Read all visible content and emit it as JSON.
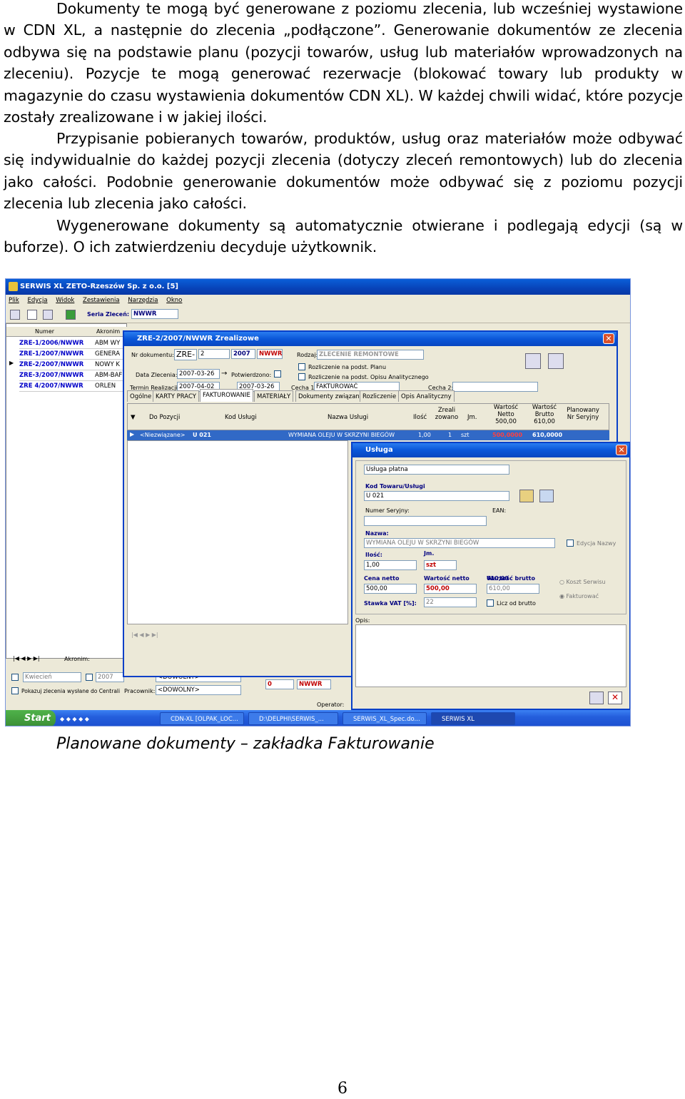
{
  "text": {
    "para1": "Dokumenty te mogą być generowane z poziomu zlecenia, lub wcześniej wystawione w CDN XL, a następnie do zlecenia „podłączone”. Generowanie dokumentów ze zlecenia odbywa się na podstawie planu (pozycji towarów, usług lub materiałów wprowadzonych na zleceniu). Pozycje te mogą generować rezerwacje (blokować towary lub produkty w magazynie do czasu wystawienia dokumentów CDN XL). W każdej chwili widać, które pozycje zostały zrealizowane  i w jakiej ilości.",
    "para2": "Przypisanie pobieranych towarów, produktów, usług oraz materiałów może odbywać się indywidualnie do każdej pozycji zlecenia (dotyczy zleceń remontowych) lub do zlecenia jako całości. Podobnie generowanie dokumentów może odbywać się z poziomu pozycji zlecenia lub zlecenia jako całości.",
    "para3": "Wygenerowane dokumenty są automatycznie otwierane i podlegają edycji (są w buforze). O ich zatwierdzeniu decyduje użytkownik.",
    "caption": "Planowane dokumenty – zakładka Fakturowanie",
    "page_number": "6"
  },
  "app": {
    "title": "SERWIS XL   ZETO-Rzeszów Sp. z o.o.  [5]",
    "menu": [
      "Plik",
      "Edycja",
      "Widok",
      "Zestawienia",
      "Narzędzia",
      "Okno"
    ],
    "seria_label": "Seria Zleceń:",
    "seria_value": "NWWR",
    "col_numer": "Numer",
    "col_akronim": "Akronim",
    "rows": [
      {
        "num": "ZRE-1/2006/NWWR",
        "akr": "ABM WY"
      },
      {
        "num": "ZRE-1/2007/NWWR",
        "akr": "GENERA"
      },
      {
        "num": "ZRE-2/2007/NWWR",
        "akr": "NOWY K"
      },
      {
        "num": "ZRE-3/2007/NWWR",
        "akr": "ABM-BAF"
      },
      {
        "num": "ZRE 4/2007/NWWR",
        "akr": "ORLEN"
      }
    ],
    "akronim_label": "Akronim:",
    "kwiecien": "Kwiecień",
    "year": "2007",
    "pokazuj": "Pokazuj zlecenia wysłane do Centrali",
    "pracownik_label": "Pracownik:",
    "pracownik_value": "<DOWOLNY>",
    "podzial_value": "<DOWOLNY>",
    "filter_num": "0",
    "filter_series": "NWWR",
    "operator_label": "Operator:"
  },
  "zre": {
    "title": "ZRE-2/2007/NWWR   Zrealizowe",
    "nr_label": "Nr dokumentu:",
    "nr_prefix": "ZRE-",
    "nr_num": "2",
    "nr_year": "2007",
    "nr_series": "NWWR",
    "rodzaj_label": "Rodzaj:",
    "rodzaj_value": "ZLECENIE REMONTOWE",
    "rozl_plan": "Rozliczenie na podst. Planu",
    "rozl_opis": "Rozliczenie na podst. Opisu Analitycznego",
    "data_label": "Data Zlecenia:",
    "data_value": "2007-03-26",
    "potw_label": "Potwierdzono:",
    "potw_value": "2007-03-26",
    "termin_label": "Termin Realizacji:",
    "termin_value": "2007-04-02",
    "cecha1_label": "Cecha 1:",
    "cecha1_value": "FAKTUROWAĆ",
    "cecha2_label": "Cecha 2:",
    "tabs": [
      "Ogólne",
      "KARTY PRACY",
      "FAKTUROWANIE",
      "MATERIAŁY",
      "Dokumenty związane",
      "Rozliczenie",
      "Opis Analityczny"
    ],
    "columns": [
      "Do Pozycji",
      "Kod Usługi",
      "Nazwa Usługi",
      "Ilość",
      "Zreali zowano",
      "Jm.",
      "Wartość Netto 500,00",
      "Wartość Brutto 610,00",
      "Planowany Nr Seryjny"
    ],
    "row": {
      "pozycja": "<Niezwiązane>",
      "kod": "U 021",
      "nazwa": "WYMIANA OLEJU W SKRZYNI BIEGÓW",
      "ilosc": "1,00",
      "zreal": "1",
      "jm": "szt",
      "netto": "500,0000",
      "brutto": "610,0000"
    }
  },
  "usluga": {
    "title": "Usługa",
    "typ": "Usługa płatna",
    "kod_label": "Kod Towaru/Usługi",
    "kod_value": "U 021",
    "seryjny_label": "Numer Seryjny:",
    "ean_label": "EAN:",
    "nazwa_label": "Nazwa:",
    "nazwa_value": "WYMIANA OLEJU W SKRZYNI BIEGÓW",
    "edycja_nazwy": "Edycja Nazwy",
    "ilosc_label": "Ilość:",
    "ilosc_value": "1,00",
    "jm_label": "Jm.",
    "jm_value": "szt",
    "cena_label": "Cena netto",
    "cena_value": "500,00",
    "wartosc_netto_label": "Wartość netto",
    "wartosc_netto_value": "500,00",
    "wartosc_brutto_label": "Wartość brutto",
    "wartosc_brutto_value": "610,00",
    "koszt": "Koszt Serwisu",
    "fakturowac": "Fakturować",
    "stawka_label": "Stawka VAT [%]:",
    "stawka_value": "22",
    "licz": "Licz od brutto",
    "opis_label": "Opis:"
  },
  "taskbar": {
    "start": "Start",
    "items": [
      "CDN-XL [OLPAK_LOC...",
      "D:\\DELPHI\\SERWIS_...",
      "SERWIS_XL_Spec.do...",
      "SERWIS XL"
    ]
  },
  "colors": {
    "xp_blue": "#0a56d8",
    "selection": "#3169c6",
    "accent_red": "#c00000"
  }
}
